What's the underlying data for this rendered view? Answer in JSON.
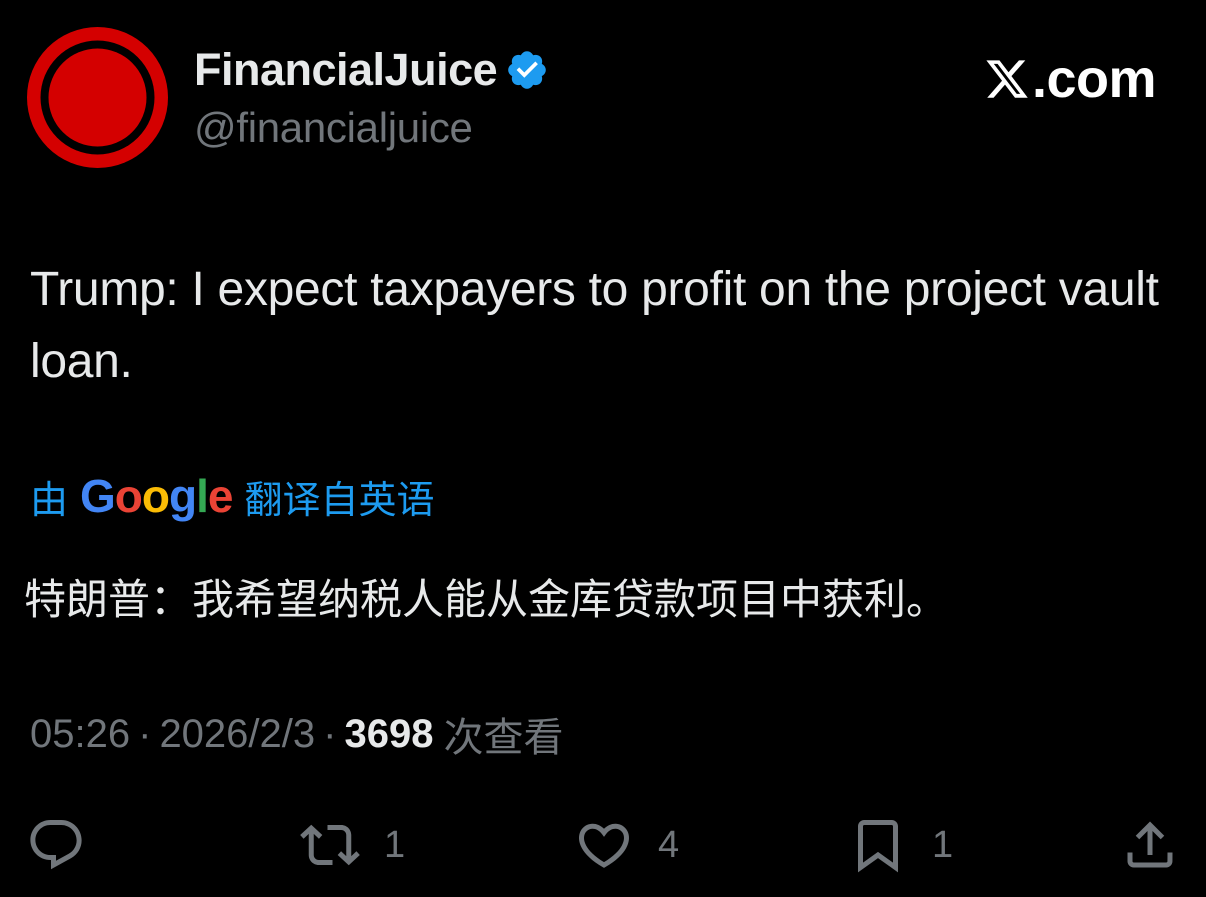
{
  "author": {
    "display_name": "FinancialJuice",
    "handle": "@financialjuice",
    "verified": true,
    "avatar_colors": {
      "ring": "#d40000",
      "inner": "#000000",
      "center": "#d40000"
    }
  },
  "brand": {
    "site_label": ".com",
    "icon": "x-logo-icon"
  },
  "tweet": {
    "text": "Trump: I expect taxpayers to profit on the project vault loan."
  },
  "translation": {
    "prefix": "由",
    "google_letters": [
      "G",
      "o",
      "o",
      "g",
      "l",
      "e"
    ],
    "suffix": "翻译自英语",
    "translated_text": "特朗普：我希望纳税人能从金库贷款项目中获利。"
  },
  "meta": {
    "time": "05:26",
    "separator": "·",
    "date": "2026/2/3",
    "views_count": "3698",
    "views_label": "次查看"
  },
  "actions": {
    "reply": {
      "icon": "reply-icon",
      "count": ""
    },
    "retweet": {
      "icon": "retweet-icon",
      "count": "1"
    },
    "like": {
      "icon": "heart-icon",
      "count": "4"
    },
    "bookmark": {
      "icon": "bookmark-icon",
      "count": "1"
    },
    "share": {
      "icon": "share-icon"
    }
  },
  "colors": {
    "background": "#000000",
    "text_primary": "#e7e9ea",
    "text_secondary": "#71767b",
    "link_blue": "#1d9bf0",
    "verified_blue": "#1d9bf0"
  }
}
